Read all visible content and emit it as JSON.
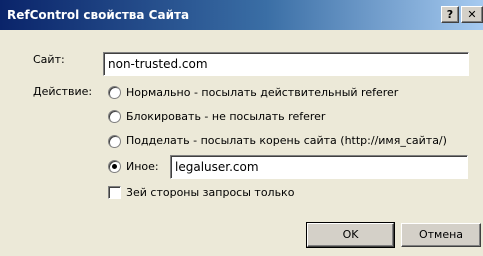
{
  "window": {
    "title": "RefControl свойства Сайта",
    "help_glyph": "?",
    "close_glyph": "✕"
  },
  "form": {
    "site_label": "Сайт:",
    "site_value": "non-trusted.com",
    "action_label": "Действие:",
    "options": [
      {
        "label": "Нормально - посылать действительный referer",
        "selected": false
      },
      {
        "label": "Блокировать - не посылать referer",
        "selected": false
      },
      {
        "label": "Подделать - посылать корень сайта (http://имя_сайта/)",
        "selected": false
      },
      {
        "label": "Иное:",
        "selected": true
      }
    ],
    "other_value": "legaluser.com",
    "third_party_label": "3ей стороны запросы только",
    "third_party_checked": false
  },
  "buttons": {
    "ok": "OK",
    "cancel": "Отмена"
  }
}
